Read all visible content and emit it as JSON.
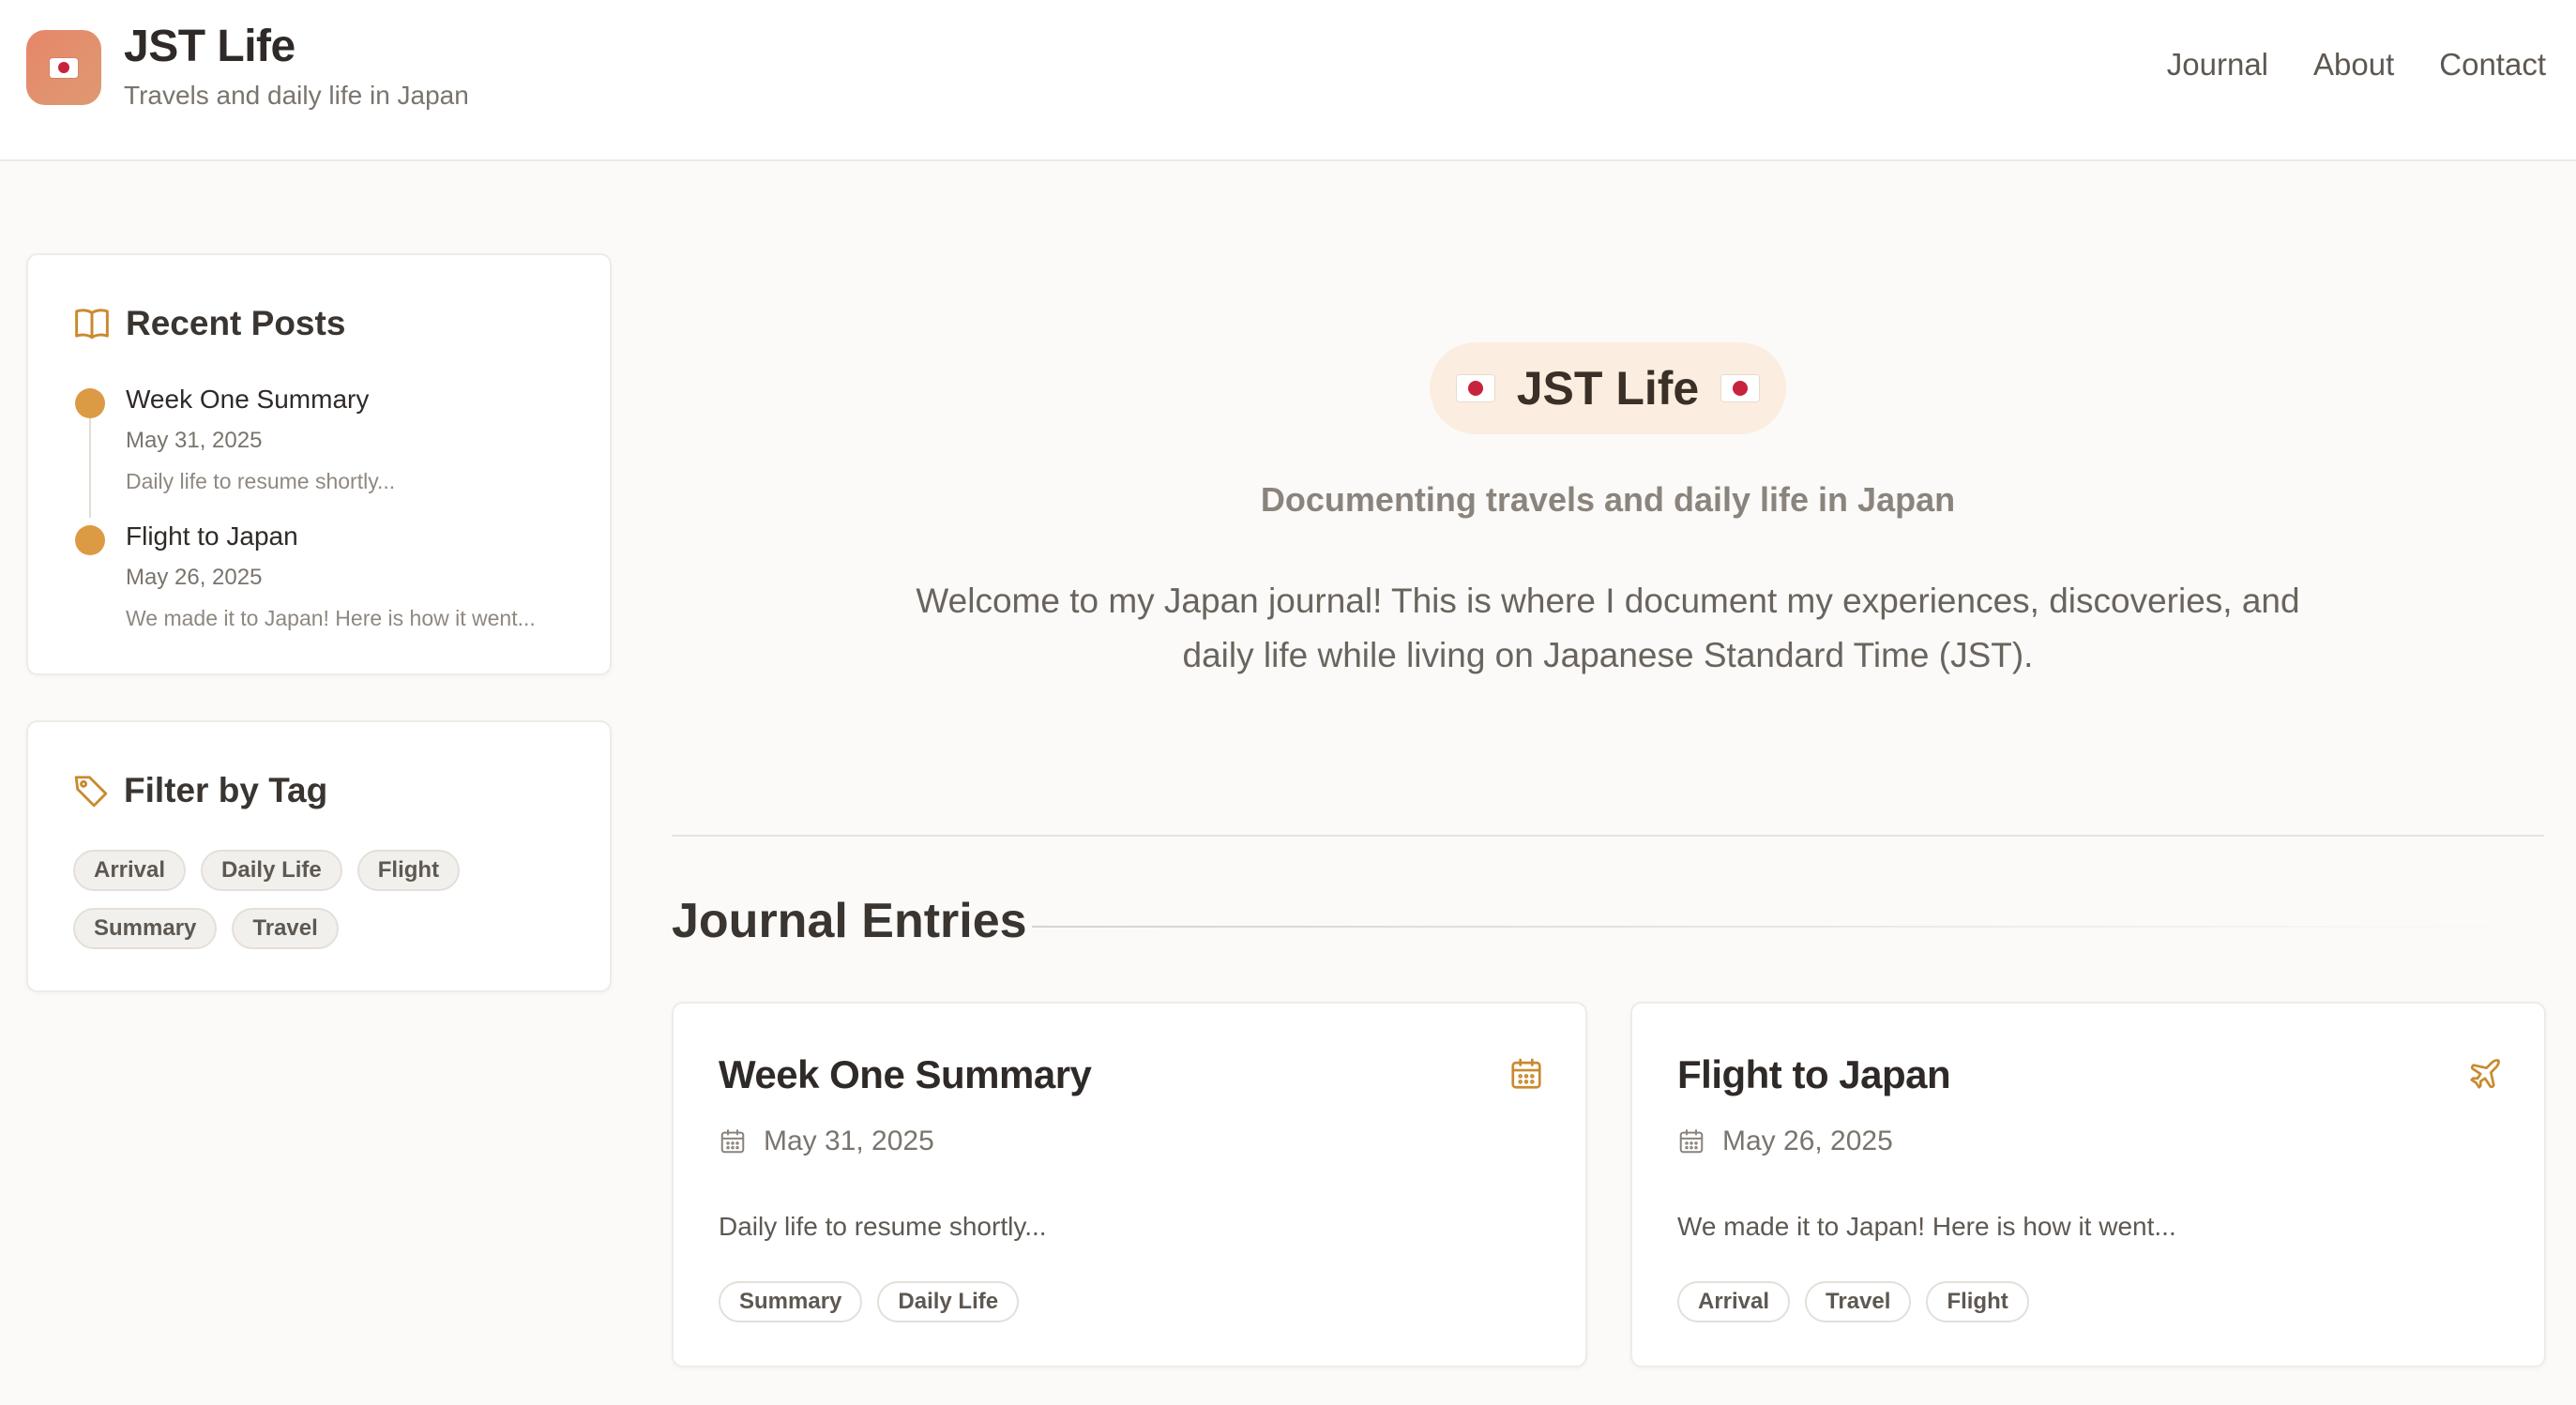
{
  "site": {
    "title": "JST Life",
    "subtitle": "Travels and daily life in Japan"
  },
  "nav": {
    "items": [
      "Journal",
      "About",
      "Contact"
    ]
  },
  "sidebar": {
    "recent": {
      "heading": "Recent Posts",
      "posts": [
        {
          "title": "Week One Summary",
          "date": "May 31, 2025",
          "excerpt": "Daily life to resume shortly..."
        },
        {
          "title": "Flight to Japan",
          "date": "May 26, 2025",
          "excerpt": "We made it to Japan! Here is how it went..."
        }
      ]
    },
    "filter": {
      "heading": "Filter by Tag",
      "tags": [
        "Arrival",
        "Daily Life",
        "Flight",
        "Summary",
        "Travel"
      ]
    }
  },
  "hero": {
    "title": "JST Life",
    "subtitle": "Documenting travels and daily life in Japan",
    "description_line1": "Welcome to my Japan journal! This is where I document my experiences, discoveries, and",
    "description_line2": "daily life while living on Japanese Standard Time (JST)."
  },
  "journal": {
    "heading": "Journal Entries",
    "entries": [
      {
        "title": "Week One Summary",
        "date": "May 31, 2025",
        "excerpt": "Daily life to resume shortly...",
        "icon": "calendar-icon",
        "tags": [
          "Summary",
          "Daily Life"
        ]
      },
      {
        "title": "Flight to Japan",
        "date": "May 26, 2025",
        "excerpt": "We made it to Japan! Here is how it went...",
        "icon": "airplane-icon",
        "tags": [
          "Arrival",
          "Travel",
          "Flight"
        ]
      }
    ]
  },
  "colors": {
    "accent": "#dd9a45",
    "logo_gradient_start": "#e8866a",
    "logo_gradient_end": "#dd9a72",
    "hero_pill_bg": "#fbeee0",
    "background": "#fbfaf8",
    "icon_accent": "#c98a2e"
  }
}
